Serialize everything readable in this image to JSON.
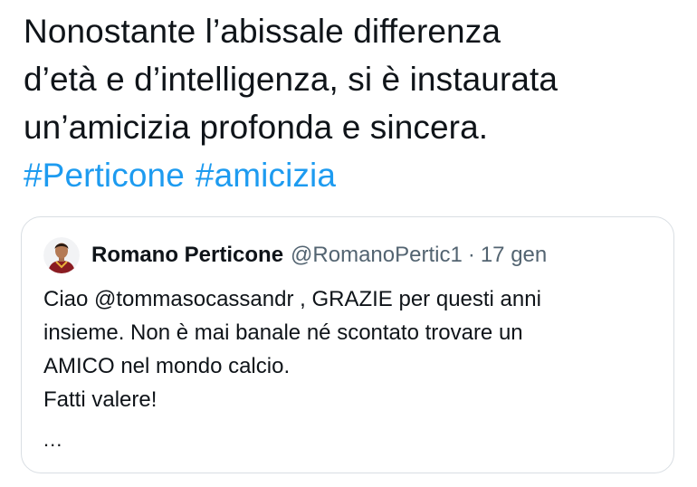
{
  "tweet": {
    "lines": [
      "Nonostante l’abissale differenza",
      "d’età e d’intelligenza, si è instaurata",
      "un’amicizia profonda e sincera."
    ],
    "hashtags": [
      "#Perticone",
      "#amicizia"
    ]
  },
  "quoted_tweet": {
    "author_name": "Romano Perticone",
    "author_handle": "@RomanoPertic1",
    "separator": "·",
    "date": "17 gen",
    "body_lines": [
      "Ciao @tommasocassandr , GRAZIE per questi anni",
      "insieme. Non è mai banale né scontato trovare un",
      "AMICO nel mondo calcio.",
      "Fatti valere!"
    ],
    "more": "..."
  },
  "colors": {
    "text": "#0f1419",
    "hashtag": "#1d9bf0",
    "secondary_text": "#536471",
    "card_border": "#d9dee3"
  }
}
